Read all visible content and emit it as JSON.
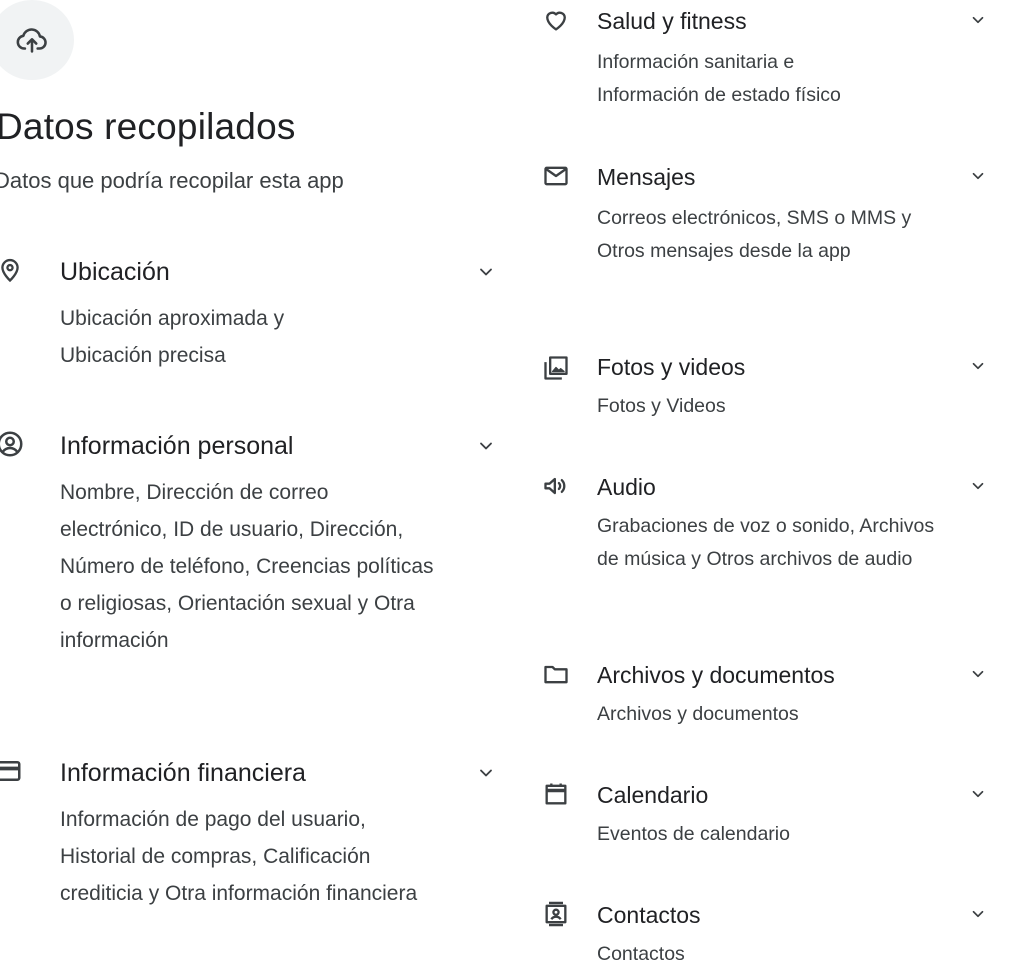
{
  "header": {
    "title": "Datos recopilados",
    "subtitle": "Datos que podría recopilar esta app"
  },
  "left_categories": [
    {
      "title": "Ubicación",
      "icon": "location-pin-icon",
      "description": "Ubicación aproximada y Ubicación precisa"
    },
    {
      "title": "Información personal",
      "icon": "account-circle-icon",
      "description": "Nombre, Dirección de correo electrónico, ID de usuario, Dirección, Número de teléfono, Creencias políticas o religiosas, Orientación sexual y Otra información"
    },
    {
      "title": "Información financiera",
      "icon": "credit-card-icon",
      "description": "Información de pago del usuario, Historial de compras, Calificación crediticia y Otra información financiera"
    }
  ],
  "right_categories": [
    {
      "title": "Salud y fitness",
      "icon": "heart-icon",
      "description": "Información sanitaria e Información de estado físico"
    },
    {
      "title": "Mensajes",
      "icon": "mail-icon",
      "description": "Correos electrónicos, SMS o MMS y Otros mensajes desde la app"
    },
    {
      "title": "Fotos y videos",
      "icon": "photo-library-icon",
      "description": "Fotos y Videos"
    },
    {
      "title": "Audio",
      "icon": "speaker-icon",
      "description": "Grabaciones de voz o sonido, Archivos de música y Otros archivos de audio"
    },
    {
      "title": "Archivos y documentos",
      "icon": "folder-icon",
      "description": "Archivos y documentos"
    },
    {
      "title": "Calendario",
      "icon": "calendar-icon",
      "description": "Eventos de calendario"
    },
    {
      "title": "Contactos",
      "icon": "contacts-icon",
      "description": "Contactos"
    }
  ],
  "icons": {
    "top": "cloud-upload-icon",
    "expand": "chevron-down-icon"
  },
  "colors": {
    "icon": "#3c4043",
    "text": "#202124",
    "secondary_text": "#3c4043",
    "icon_circle_bg": "#f1f3f4"
  }
}
